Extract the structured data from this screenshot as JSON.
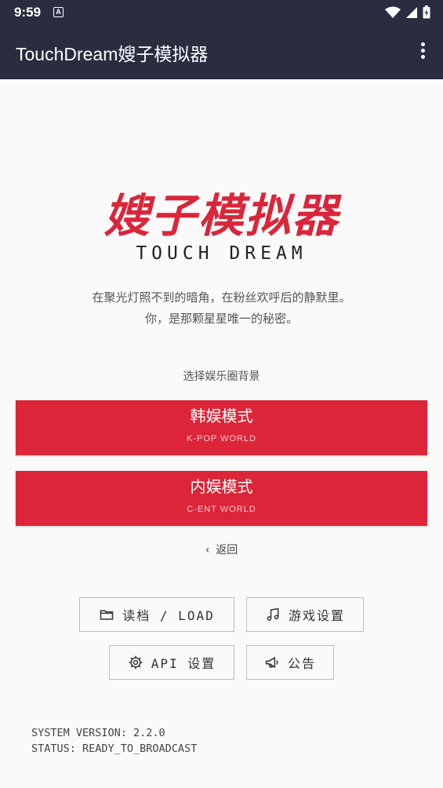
{
  "status_bar": {
    "time": "9:59",
    "notification_letter": "A"
  },
  "app_bar": {
    "title": "TouchDream嫂子模拟器"
  },
  "logo": {
    "title": "嫂子模拟器",
    "subtitle": "TOUCH DREAM"
  },
  "tagline": {
    "line1": "在聚光灯照不到的暗角，在粉丝欢呼后的静默里。",
    "line2": "你，是那颗星星唯一的秘密。"
  },
  "mode_select": {
    "label": "选择娱乐圈背景",
    "modes": [
      {
        "name": "韩娱模式",
        "sub": "K-POP WORLD"
      },
      {
        "name": "内娱模式",
        "sub": "C-ENT WORLD"
      }
    ],
    "back_label": "返回"
  },
  "actions": {
    "load": "读档 / LOAD",
    "game_settings": "游戏设置",
    "api_settings": "API 设置",
    "announcement": "公告"
  },
  "system": {
    "version": "SYSTEM VERSION: 2.2.0",
    "status": "STATUS: READY_TO_BROADCAST"
  },
  "colors": {
    "appbar": "#2a2d40",
    "accent": "#dc2539",
    "background": "#fafafa"
  }
}
